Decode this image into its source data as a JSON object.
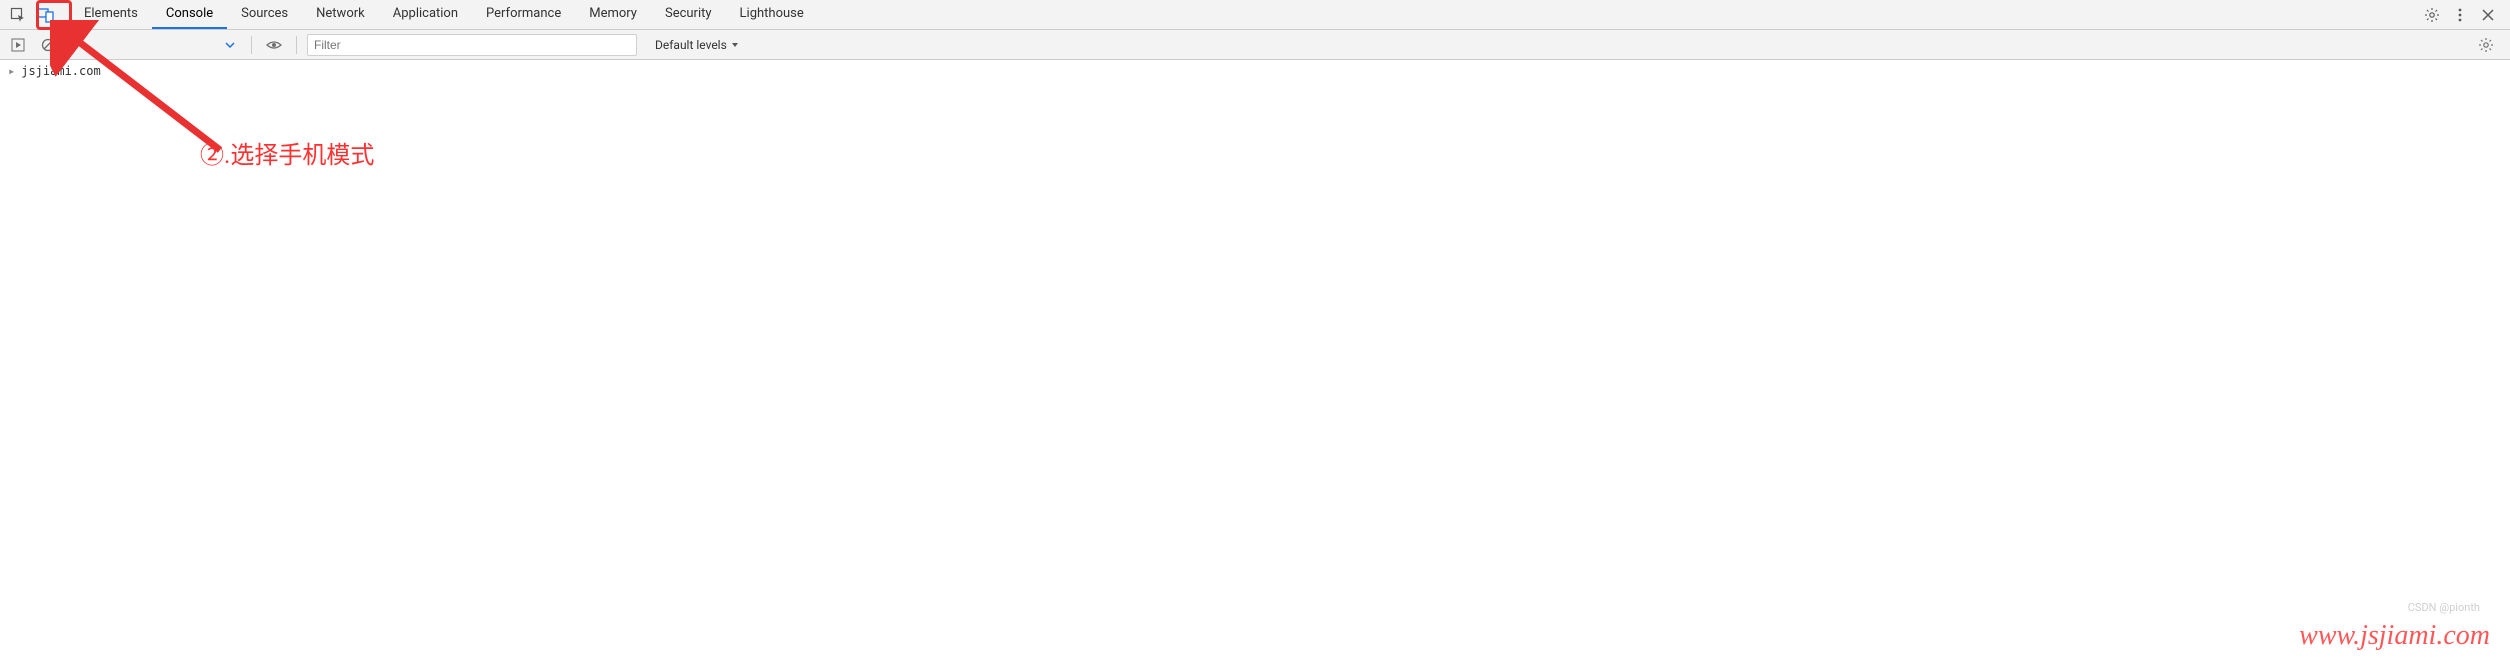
{
  "tabs": [
    "Elements",
    "Console",
    "Sources",
    "Network",
    "Application",
    "Performance",
    "Memory",
    "Security",
    "Lighthouse"
  ],
  "active_tab_index": 1,
  "subbar": {
    "filter_placeholder": "Filter",
    "levels_label": "Default levels"
  },
  "console": {
    "line1": "jsjiami.com"
  },
  "annotation": {
    "text": "②.选择手机模式"
  },
  "watermark": "www.jsjiami.com",
  "watermark2": "CSDN @pionth"
}
